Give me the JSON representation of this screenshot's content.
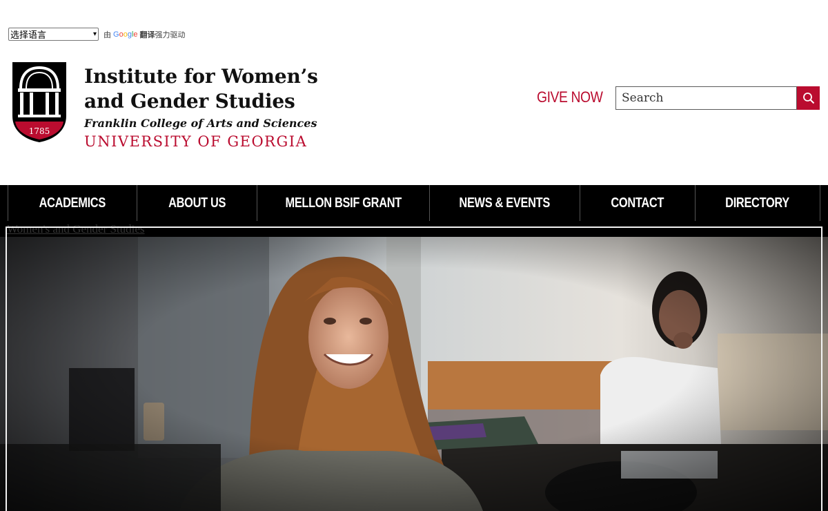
{
  "translate": {
    "select_value": "选择语言",
    "powered_prefix": "由",
    "google_letters": [
      "G",
      "o",
      "o",
      "g",
      "l",
      "e"
    ],
    "translate_word": "翻译",
    "powered_suffix": "强力驱动"
  },
  "logo": {
    "title_line1": "Institute for Women’s",
    "title_line2": "and Gender Studies",
    "college": "Franklin College of Arts and Sciences",
    "university": "UNIVERSITY OF GEORGIA",
    "arch_year": "1785"
  },
  "header": {
    "give_now": "GIVE NOW",
    "search_placeholder": "Search"
  },
  "nav": {
    "items": [
      {
        "label": "ACADEMICS"
      },
      {
        "label": "ABOUT US"
      },
      {
        "label": "MELLON BSIF GRANT"
      },
      {
        "label": "NEWS & EVENTS"
      },
      {
        "label": "CONTACT"
      },
      {
        "label": "DIRECTORY"
      }
    ]
  },
  "breadcrumb": "Women's and Gender Studies",
  "colors": {
    "brand_red": "#ba0c2f",
    "nav_bg": "#000000"
  }
}
